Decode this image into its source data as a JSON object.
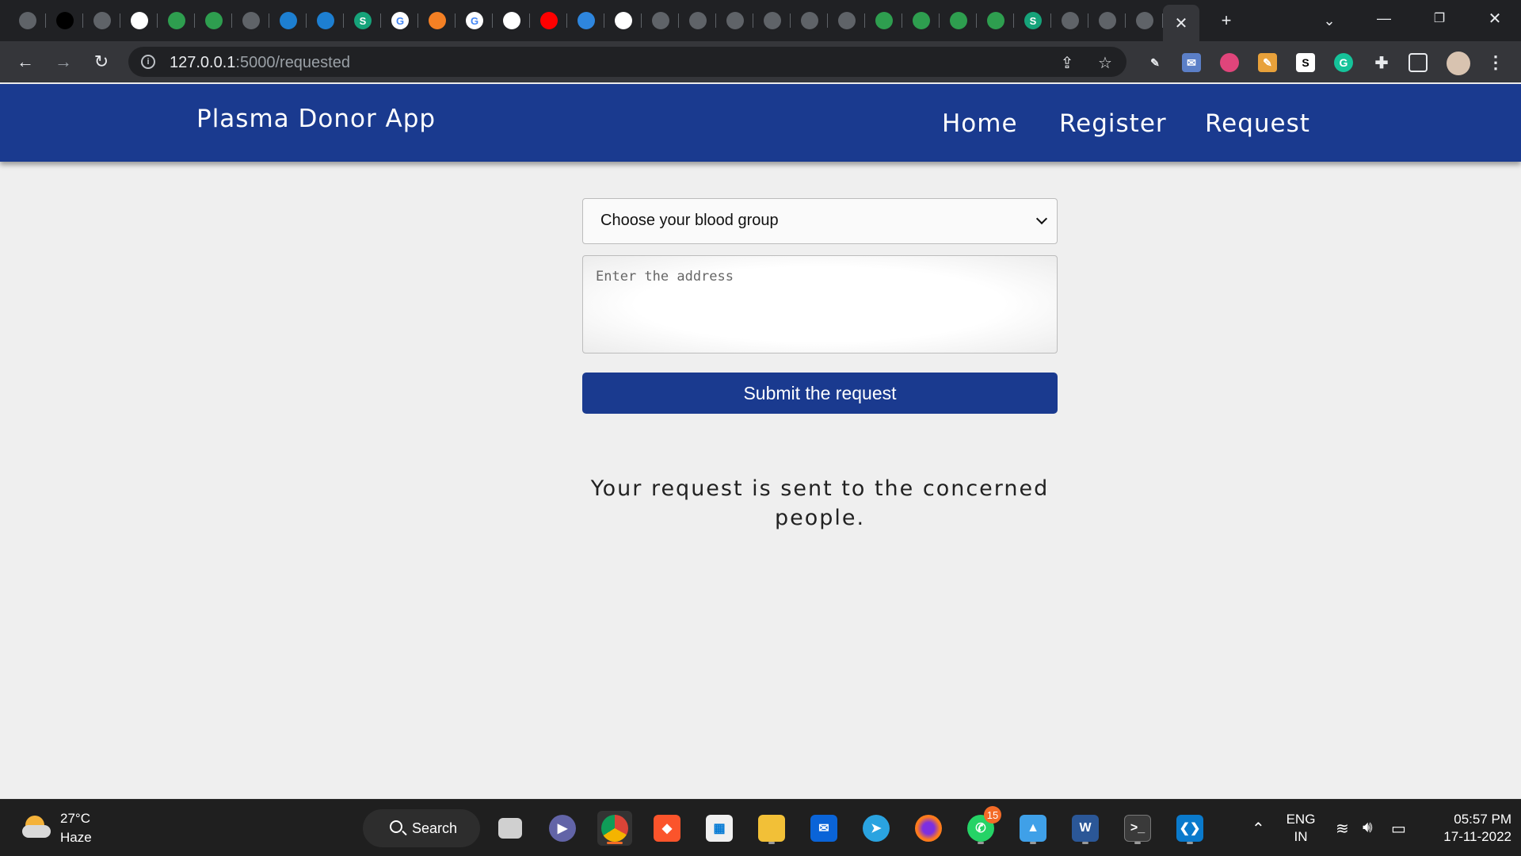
{
  "browser": {
    "tabs": [
      {
        "icon": "globe-icon",
        "color": "#5f6368",
        "glyph": ""
      },
      {
        "icon": "github-icon",
        "color": "#000000",
        "glyph": ""
      },
      {
        "icon": "globe-icon",
        "color": "#5f6368",
        "glyph": ""
      },
      {
        "icon": "cube-icon",
        "color": "#ffffff",
        "glyph": ""
      },
      {
        "icon": "green-shield-icon",
        "color": "#2e9e4f",
        "glyph": ""
      },
      {
        "icon": "green-shield-icon",
        "color": "#2e9e4f",
        "glyph": ""
      },
      {
        "icon": "globe-icon",
        "color": "#5f6368",
        "glyph": ""
      },
      {
        "icon": "ibm-cloud-icon",
        "color": "#1d7fd1",
        "glyph": ""
      },
      {
        "icon": "bar-chart-icon",
        "color": "#1d7fd1",
        "glyph": ""
      },
      {
        "icon": "s-icon",
        "color": "#16a37a",
        "glyph": "S"
      },
      {
        "icon": "google-icon",
        "color": "#ffffff",
        "glyph": "G"
      },
      {
        "icon": "stackoverflow-icon",
        "color": "#f48024",
        "glyph": ""
      },
      {
        "icon": "google-icon",
        "color": "#ffffff",
        "glyph": "G"
      },
      {
        "icon": "chatgpt-icon",
        "color": "#ffffff",
        "glyph": ""
      },
      {
        "icon": "youtube-icon",
        "color": "#ff0000",
        "glyph": ""
      },
      {
        "icon": "stack-icon",
        "color": "#2e86de",
        "glyph": ""
      },
      {
        "icon": "chatgpt-icon",
        "color": "#ffffff",
        "glyph": ""
      },
      {
        "icon": "globe-icon",
        "color": "#5f6368",
        "glyph": ""
      },
      {
        "icon": "globe-icon",
        "color": "#5f6368",
        "glyph": ""
      },
      {
        "icon": "globe-icon",
        "color": "#5f6368",
        "glyph": ""
      },
      {
        "icon": "globe-icon",
        "color": "#5f6368",
        "glyph": ""
      },
      {
        "icon": "globe-icon",
        "color": "#5f6368",
        "glyph": ""
      },
      {
        "icon": "globe-icon",
        "color": "#5f6368",
        "glyph": ""
      },
      {
        "icon": "green-shield-icon",
        "color": "#2e9e4f",
        "glyph": ""
      },
      {
        "icon": "green-shield-icon",
        "color": "#2e9e4f",
        "glyph": ""
      },
      {
        "icon": "green-shield-icon",
        "color": "#2e9e4f",
        "glyph": ""
      },
      {
        "icon": "green-shield-icon",
        "color": "#2e9e4f",
        "glyph": ""
      },
      {
        "icon": "s-icon",
        "color": "#16a37a",
        "glyph": "S"
      },
      {
        "icon": "globe-icon",
        "color": "#5f6368",
        "glyph": ""
      },
      {
        "icon": "globe-icon",
        "color": "#5f6368",
        "glyph": ""
      },
      {
        "icon": "globe-icon",
        "color": "#5f6368",
        "glyph": ""
      }
    ],
    "url_host": "127.0.0.1",
    "url_path": ":5000/requested"
  },
  "app": {
    "brand": "Plasma Donor App",
    "nav": {
      "home": "Home",
      "register": "Register",
      "request": "Request"
    },
    "accent_color": "#1a3a8f"
  },
  "form": {
    "blood_group_selected": "Choose your blood group",
    "address_placeholder": "Enter the address",
    "submit_label": "Submit the request"
  },
  "message": "Your request is sent to the concerned people.",
  "taskbar": {
    "weather_temp": "27°C",
    "weather_desc": "Haze",
    "search_label": "Search",
    "whatsapp_badge": "15",
    "lang_top": "ENG",
    "lang_bottom": "IN",
    "time": "05:57 PM",
    "date": "17-11-2022"
  }
}
